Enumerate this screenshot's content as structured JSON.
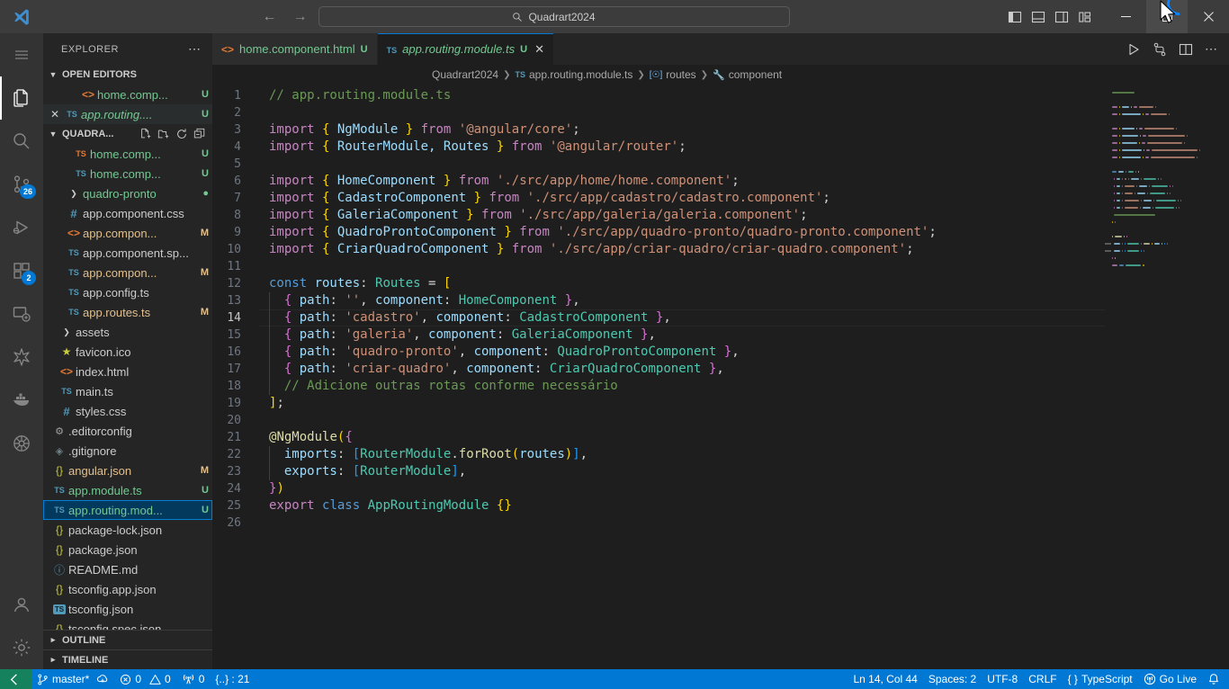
{
  "titlebar": {
    "search_value": "Quadrart2024",
    "back_label": "←",
    "forward_label": "→",
    "minimize_label": "–",
    "close_label": "✕"
  },
  "activitybar": {
    "items": [
      {
        "name": "menu",
        "badge": ""
      },
      {
        "name": "explorer",
        "badge": ""
      },
      {
        "name": "search",
        "badge": ""
      },
      {
        "name": "source-control",
        "badge": "26"
      },
      {
        "name": "run-and-debug",
        "badge": ""
      },
      {
        "name": "extensions",
        "badge": "2"
      },
      {
        "name": "remote-explorer",
        "badge": ""
      },
      {
        "name": "testing",
        "badge": ""
      },
      {
        "name": "docker",
        "badge": ""
      },
      {
        "name": "kubernetes",
        "badge": ""
      },
      {
        "name": "accounts",
        "badge": ""
      },
      {
        "name": "settings",
        "badge": ""
      }
    ]
  },
  "sidebar": {
    "title": "EXPLORER",
    "open_editors": {
      "label": "OPEN EDITORS",
      "items": [
        {
          "name": "home.comp...",
          "badge": "U",
          "icon": "html",
          "active": false
        },
        {
          "name": "app.routing....",
          "badge": "U",
          "icon": "ts",
          "active": true
        }
      ]
    },
    "project": {
      "label": "QUADRA...",
      "items": [
        {
          "name": "home.comp...",
          "badge": "U",
          "icon": "ts-orange",
          "indent": 3,
          "state": "untracked"
        },
        {
          "name": "home.comp...",
          "badge": "U",
          "icon": "ts",
          "indent": 3,
          "state": "untracked"
        },
        {
          "name": "quadro-pronto",
          "badge": "●",
          "icon": "folder",
          "indent": 2,
          "state": "untracked"
        },
        {
          "name": "app.component.css",
          "badge": "",
          "icon": "css",
          "indent": 2,
          "state": "normal"
        },
        {
          "name": "app.compon...",
          "badge": "M",
          "icon": "html",
          "indent": 2,
          "state": "modified"
        },
        {
          "name": "app.component.sp...",
          "badge": "",
          "icon": "ts",
          "indent": 2,
          "state": "normal"
        },
        {
          "name": "app.compon...",
          "badge": "M",
          "icon": "ts",
          "indent": 2,
          "state": "modified"
        },
        {
          "name": "app.config.ts",
          "badge": "",
          "icon": "ts",
          "indent": 2,
          "state": "normal"
        },
        {
          "name": "app.routes.ts",
          "badge": "M",
          "icon": "ts",
          "indent": 2,
          "state": "modified"
        },
        {
          "name": "assets",
          "badge": "",
          "icon": "folder",
          "indent": 1,
          "state": "normal"
        },
        {
          "name": "favicon.ico",
          "badge": "",
          "icon": "star",
          "indent": 1,
          "state": "normal"
        },
        {
          "name": "index.html",
          "badge": "",
          "icon": "html",
          "indent": 1,
          "state": "normal"
        },
        {
          "name": "main.ts",
          "badge": "",
          "icon": "ts",
          "indent": 1,
          "state": "normal"
        },
        {
          "name": "styles.css",
          "badge": "",
          "icon": "css",
          "indent": 1,
          "state": "normal"
        },
        {
          "name": ".editorconfig",
          "badge": "",
          "icon": "gear",
          "indent": 0,
          "state": "normal"
        },
        {
          "name": ".gitignore",
          "badge": "",
          "icon": "git",
          "indent": 0,
          "state": "normal"
        },
        {
          "name": "angular.json",
          "badge": "M",
          "icon": "json",
          "indent": 0,
          "state": "modified"
        },
        {
          "name": "app.module.ts",
          "badge": "U",
          "icon": "ts",
          "indent": 0,
          "state": "untracked"
        },
        {
          "name": "app.routing.mod...",
          "badge": "U",
          "icon": "ts",
          "indent": 0,
          "state": "untracked",
          "selected": true
        },
        {
          "name": "package-lock.json",
          "badge": "",
          "icon": "json",
          "indent": 0,
          "state": "normal"
        },
        {
          "name": "package.json",
          "badge": "",
          "icon": "json",
          "indent": 0,
          "state": "normal"
        },
        {
          "name": "README.md",
          "badge": "",
          "icon": "md",
          "indent": 0,
          "state": "normal"
        },
        {
          "name": "tsconfig.app.json",
          "badge": "",
          "icon": "json",
          "indent": 0,
          "state": "normal"
        },
        {
          "name": "tsconfig.json",
          "badge": "",
          "icon": "tsjson",
          "indent": 0,
          "state": "normal"
        },
        {
          "name": "tsconfig.spec.json",
          "badge": "",
          "icon": "json",
          "indent": 0,
          "state": "normal"
        }
      ]
    },
    "outline_label": "OUTLINE",
    "timeline_label": "TIMELINE"
  },
  "tabs": [
    {
      "name": "home.component.html",
      "badge": "U",
      "icon": "html",
      "active": false,
      "closable": false
    },
    {
      "name": "app.routing.module.ts",
      "badge": "U",
      "icon": "ts",
      "active": true,
      "closable": true
    }
  ],
  "breadcrumbs": [
    {
      "label": "Quadrart2024",
      "icon": ""
    },
    {
      "label": "app.routing.module.ts",
      "icon": "ts"
    },
    {
      "label": "routes",
      "icon": "variable"
    },
    {
      "label": "component",
      "icon": "property"
    }
  ],
  "editor": {
    "language": "TypeScript",
    "cursor": "Ln 14, Col 44",
    "current_line": 14,
    "lines": [
      {
        "n": 1,
        "tokens": [
          {
            "t": "// app.routing.module.ts",
            "c": "t-com"
          }
        ]
      },
      {
        "n": 2,
        "tokens": []
      },
      {
        "n": 3,
        "tokens": [
          {
            "t": "import ",
            "c": "t-kw"
          },
          {
            "t": "{",
            "c": "t-b1"
          },
          {
            "t": " NgModule ",
            "c": "t-var"
          },
          {
            "t": "}",
            "c": "t-b1"
          },
          {
            "t": " from ",
            "c": "t-kw"
          },
          {
            "t": "'@angular/core'",
            "c": "t-str"
          },
          {
            "t": ";",
            "c": "t-pun"
          }
        ]
      },
      {
        "n": 4,
        "tokens": [
          {
            "t": "import ",
            "c": "t-kw"
          },
          {
            "t": "{",
            "c": "t-b1"
          },
          {
            "t": " RouterModule, Routes ",
            "c": "t-var"
          },
          {
            "t": "}",
            "c": "t-b1"
          },
          {
            "t": " from ",
            "c": "t-kw"
          },
          {
            "t": "'@angular/router'",
            "c": "t-str"
          },
          {
            "t": ";",
            "c": "t-pun"
          }
        ]
      },
      {
        "n": 5,
        "tokens": []
      },
      {
        "n": 6,
        "tokens": [
          {
            "t": "import ",
            "c": "t-kw"
          },
          {
            "t": "{",
            "c": "t-b1"
          },
          {
            "t": " HomeComponent ",
            "c": "t-var"
          },
          {
            "t": "}",
            "c": "t-b1"
          },
          {
            "t": " from ",
            "c": "t-kw"
          },
          {
            "t": "'./src/app/home/home.component'",
            "c": "t-str"
          },
          {
            "t": ";",
            "c": "t-pun"
          }
        ]
      },
      {
        "n": 7,
        "tokens": [
          {
            "t": "import ",
            "c": "t-kw"
          },
          {
            "t": "{",
            "c": "t-b1"
          },
          {
            "t": " CadastroComponent ",
            "c": "t-var"
          },
          {
            "t": "}",
            "c": "t-b1"
          },
          {
            "t": " from ",
            "c": "t-kw"
          },
          {
            "t": "'./src/app/cadastro/cadastro.component'",
            "c": "t-str"
          },
          {
            "t": ";",
            "c": "t-pun"
          }
        ]
      },
      {
        "n": 8,
        "tokens": [
          {
            "t": "import ",
            "c": "t-kw"
          },
          {
            "t": "{",
            "c": "t-b1"
          },
          {
            "t": " GaleriaComponent ",
            "c": "t-var"
          },
          {
            "t": "}",
            "c": "t-b1"
          },
          {
            "t": " from ",
            "c": "t-kw"
          },
          {
            "t": "'./src/app/galeria/galeria.component'",
            "c": "t-str"
          },
          {
            "t": ";",
            "c": "t-pun"
          }
        ]
      },
      {
        "n": 9,
        "tokens": [
          {
            "t": "import ",
            "c": "t-kw"
          },
          {
            "t": "{",
            "c": "t-b1"
          },
          {
            "t": " QuadroProntoComponent ",
            "c": "t-var"
          },
          {
            "t": "}",
            "c": "t-b1"
          },
          {
            "t": " from ",
            "c": "t-kw"
          },
          {
            "t": "'./src/app/quadro-pronto/quadro-pronto.component'",
            "c": "t-str"
          },
          {
            "t": ";",
            "c": "t-pun"
          }
        ]
      },
      {
        "n": 10,
        "tokens": [
          {
            "t": "import ",
            "c": "t-kw"
          },
          {
            "t": "{",
            "c": "t-b1"
          },
          {
            "t": " CriarQuadroComponent ",
            "c": "t-var"
          },
          {
            "t": "}",
            "c": "t-b1"
          },
          {
            "t": " from ",
            "c": "t-kw"
          },
          {
            "t": "'./src/app/criar-quadro/criar-quadro.component'",
            "c": "t-str"
          },
          {
            "t": ";",
            "c": "t-pun"
          }
        ]
      },
      {
        "n": 11,
        "tokens": []
      },
      {
        "n": 12,
        "tokens": [
          {
            "t": "const ",
            "c": "t-kw2"
          },
          {
            "t": "routes",
            "c": "t-var"
          },
          {
            "t": ": ",
            "c": "t-pun"
          },
          {
            "t": "Routes",
            "c": "t-type"
          },
          {
            "t": " = ",
            "c": "t-pun"
          },
          {
            "t": "[",
            "c": "t-b1"
          }
        ]
      },
      {
        "n": 13,
        "tokens": [
          {
            "t": "  ",
            "c": "t-pun"
          },
          {
            "t": "{",
            "c": "t-b2"
          },
          {
            "t": " path",
            "c": "t-var"
          },
          {
            "t": ": ",
            "c": "t-pun"
          },
          {
            "t": "''",
            "c": "t-str"
          },
          {
            "t": ", ",
            "c": "t-pun"
          },
          {
            "t": "component",
            "c": "t-var"
          },
          {
            "t": ": ",
            "c": "t-pun"
          },
          {
            "t": "HomeComponent",
            "c": "t-type"
          },
          {
            "t": " ",
            "c": "t-pun"
          },
          {
            "t": "}",
            "c": "t-b2"
          },
          {
            "t": ",",
            "c": "t-pun"
          }
        ]
      },
      {
        "n": 14,
        "tokens": [
          {
            "t": "  ",
            "c": "t-pun"
          },
          {
            "t": "{",
            "c": "t-b2"
          },
          {
            "t": " path",
            "c": "t-var"
          },
          {
            "t": ": ",
            "c": "t-pun"
          },
          {
            "t": "'cadastro'",
            "c": "t-str"
          },
          {
            "t": ", ",
            "c": "t-pun"
          },
          {
            "t": "component",
            "c": "t-var"
          },
          {
            "t": ": ",
            "c": "t-pun"
          },
          {
            "t": "CadastroComponent",
            "c": "t-type"
          },
          {
            "t": " ",
            "c": "t-pun"
          },
          {
            "t": "}",
            "c": "t-b2"
          },
          {
            "t": ",",
            "c": "t-pun"
          }
        ]
      },
      {
        "n": 15,
        "tokens": [
          {
            "t": "  ",
            "c": "t-pun"
          },
          {
            "t": "{",
            "c": "t-b2"
          },
          {
            "t": " path",
            "c": "t-var"
          },
          {
            "t": ": ",
            "c": "t-pun"
          },
          {
            "t": "'galeria'",
            "c": "t-str"
          },
          {
            "t": ", ",
            "c": "t-pun"
          },
          {
            "t": "component",
            "c": "t-var"
          },
          {
            "t": ": ",
            "c": "t-pun"
          },
          {
            "t": "GaleriaComponent",
            "c": "t-type"
          },
          {
            "t": " ",
            "c": "t-pun"
          },
          {
            "t": "}",
            "c": "t-b2"
          },
          {
            "t": ",",
            "c": "t-pun"
          }
        ]
      },
      {
        "n": 16,
        "tokens": [
          {
            "t": "  ",
            "c": "t-pun"
          },
          {
            "t": "{",
            "c": "t-b2"
          },
          {
            "t": " path",
            "c": "t-var"
          },
          {
            "t": ": ",
            "c": "t-pun"
          },
          {
            "t": "'quadro-pronto'",
            "c": "t-str"
          },
          {
            "t": ", ",
            "c": "t-pun"
          },
          {
            "t": "component",
            "c": "t-var"
          },
          {
            "t": ": ",
            "c": "t-pun"
          },
          {
            "t": "QuadroProntoComponent",
            "c": "t-type"
          },
          {
            "t": " ",
            "c": "t-pun"
          },
          {
            "t": "}",
            "c": "t-b2"
          },
          {
            "t": ",",
            "c": "t-pun"
          }
        ]
      },
      {
        "n": 17,
        "tokens": [
          {
            "t": "  ",
            "c": "t-pun"
          },
          {
            "t": "{",
            "c": "t-b2"
          },
          {
            "t": " path",
            "c": "t-var"
          },
          {
            "t": ": ",
            "c": "t-pun"
          },
          {
            "t": "'criar-quadro'",
            "c": "t-str"
          },
          {
            "t": ", ",
            "c": "t-pun"
          },
          {
            "t": "component",
            "c": "t-var"
          },
          {
            "t": ": ",
            "c": "t-pun"
          },
          {
            "t": "CriarQuadroComponent",
            "c": "t-type"
          },
          {
            "t": " ",
            "c": "t-pun"
          },
          {
            "t": "}",
            "c": "t-b2"
          },
          {
            "t": ",",
            "c": "t-pun"
          }
        ]
      },
      {
        "n": 18,
        "tokens": [
          {
            "t": "  // Adicione outras rotas conforme necessário",
            "c": "t-com"
          }
        ]
      },
      {
        "n": 19,
        "tokens": [
          {
            "t": "]",
            "c": "t-b1"
          },
          {
            "t": ";",
            "c": "t-pun"
          }
        ]
      },
      {
        "n": 20,
        "tokens": []
      },
      {
        "n": 21,
        "tokens": [
          {
            "t": "@",
            "c": "t-fn"
          },
          {
            "t": "NgModule",
            "c": "t-fn"
          },
          {
            "t": "(",
            "c": "t-b1"
          },
          {
            "t": "{",
            "c": "t-b2"
          }
        ]
      },
      {
        "n": 22,
        "tokens": [
          {
            "t": "  ",
            "c": "t-pun"
          },
          {
            "t": "imports",
            "c": "t-var"
          },
          {
            "t": ": ",
            "c": "t-pun"
          },
          {
            "t": "[",
            "c": "t-b3"
          },
          {
            "t": "RouterModule",
            "c": "t-type"
          },
          {
            "t": ".",
            "c": "t-pun"
          },
          {
            "t": "forRoot",
            "c": "t-fn"
          },
          {
            "t": "(",
            "c": "t-b1"
          },
          {
            "t": "routes",
            "c": "t-var"
          },
          {
            "t": ")",
            "c": "t-b1"
          },
          {
            "t": "]",
            "c": "t-b3"
          },
          {
            "t": ",",
            "c": "t-pun"
          }
        ]
      },
      {
        "n": 23,
        "tokens": [
          {
            "t": "  ",
            "c": "t-pun"
          },
          {
            "t": "exports",
            "c": "t-var"
          },
          {
            "t": ": ",
            "c": "t-pun"
          },
          {
            "t": "[",
            "c": "t-b3"
          },
          {
            "t": "RouterModule",
            "c": "t-type"
          },
          {
            "t": "]",
            "c": "t-b3"
          },
          {
            "t": ",",
            "c": "t-pun"
          }
        ]
      },
      {
        "n": 24,
        "tokens": [
          {
            "t": "}",
            "c": "t-b2"
          },
          {
            "t": ")",
            "c": "t-b1"
          }
        ]
      },
      {
        "n": 25,
        "tokens": [
          {
            "t": "export ",
            "c": "t-kw"
          },
          {
            "t": "class ",
            "c": "t-kw2"
          },
          {
            "t": "AppRoutingModule",
            "c": "t-type"
          },
          {
            "t": " ",
            "c": "t-pun"
          },
          {
            "t": "{}",
            "c": "t-b1"
          }
        ]
      },
      {
        "n": 26,
        "tokens": []
      }
    ]
  },
  "statusbar": {
    "remote_label": "",
    "branch": "master*",
    "errors": "0",
    "warnings": "0",
    "ports": "0",
    "brackets": "{..} : 21",
    "cursor": "Ln 14, Col 44",
    "indentation": "Spaces: 2",
    "encoding": "UTF-8",
    "eol": "CRLF",
    "language": "TypeScript",
    "golive": "Go Live"
  },
  "colors": {
    "accent": "#0078d4",
    "remote_green": "#16825d",
    "selected_blue": "#04395e",
    "badge_blue": "#0078d4",
    "untracked_green": "#73c991",
    "modified_tan": "#e2c08d"
  }
}
